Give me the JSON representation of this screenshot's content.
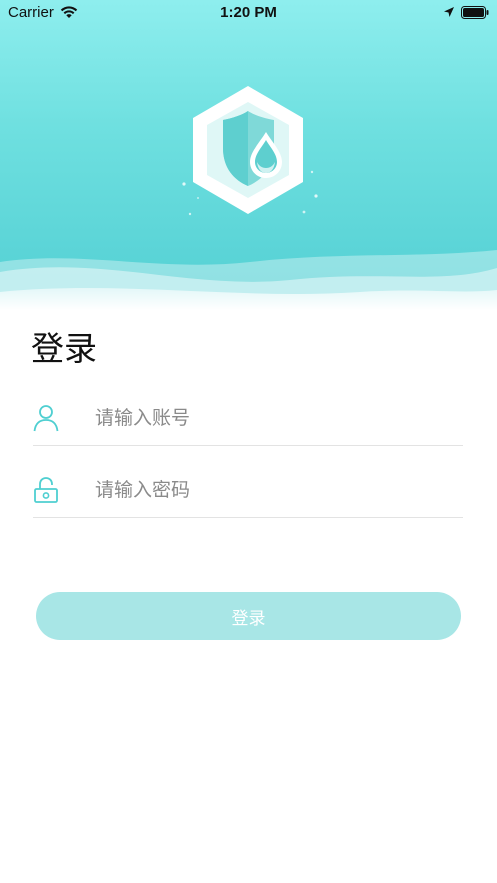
{
  "status_bar": {
    "carrier": "Carrier",
    "time": "1:20 PM"
  },
  "login": {
    "title": "登录",
    "account_placeholder": "请输入账号",
    "password_placeholder": "请输入密码",
    "button_label": "登录"
  },
  "icons": {
    "logo": "shield-water-drop-icon",
    "account": "user-icon",
    "password": "lock-icon"
  },
  "colors": {
    "accent": "#4fcfd1",
    "header_top": "#8eeeee",
    "header_bottom": "#52cfd3",
    "button_bg": "#a8e6e6",
    "button_text": "#ffffff",
    "placeholder": "#8a8a8a"
  }
}
